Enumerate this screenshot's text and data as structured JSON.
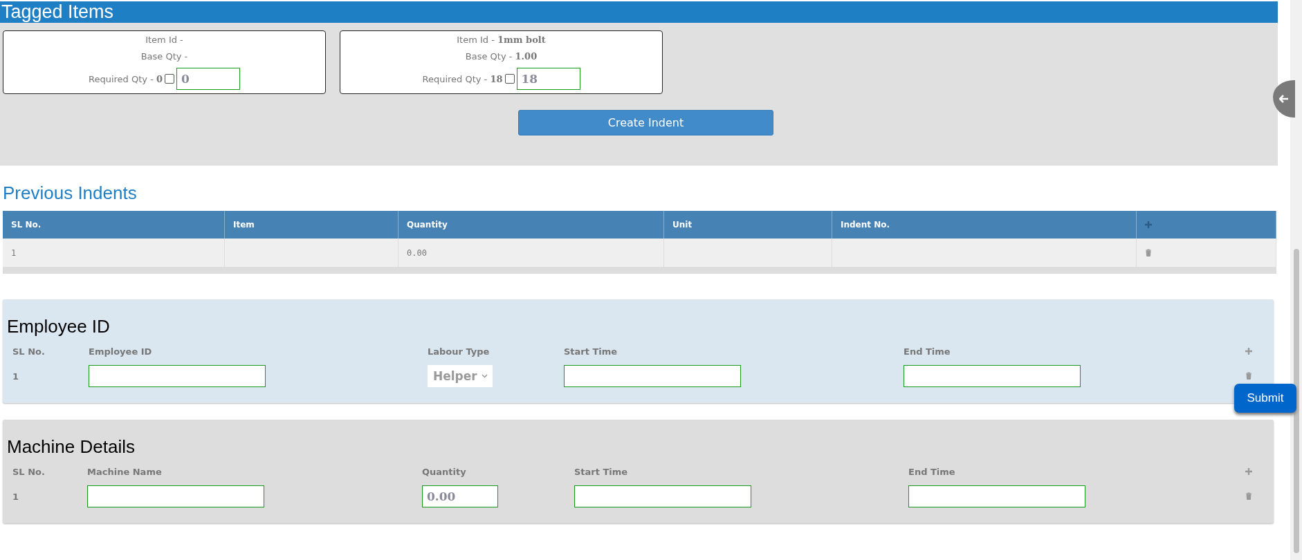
{
  "tagged_items": {
    "title": "Tagged Items",
    "cards": [
      {
        "item_id_label": "Item Id -",
        "base_qty_label": "Base Qty -",
        "required_label": "Required Qty -",
        "required_qty": "0",
        "checked": false,
        "value": "0"
      },
      {
        "item_id_label": "Item Id -",
        "item_id": "1mm bolt",
        "base_qty_label": "Base Qty -",
        "base_qty": "1.00",
        "required_label": "Required Qty -",
        "required_qty": "18",
        "checked": false,
        "value": "18"
      }
    ],
    "button": "Create Indent"
  },
  "previous_indents": {
    "title": "Previous Indents",
    "columns": [
      "SL No.",
      "Item",
      "Quantity",
      "Unit",
      "Indent No."
    ],
    "rows": [
      {
        "sl": "1",
        "quantity": "0.00"
      }
    ]
  },
  "employee": {
    "title": "Employee ID",
    "columns": [
      "SL No.",
      "Employee ID",
      "Labour Type",
      "Start Time",
      "End Time"
    ],
    "rows": [
      {
        "sl": "1",
        "labour_type": "Helper"
      }
    ]
  },
  "machine": {
    "title": "Machine Details",
    "columns": [
      "SL No.",
      "Machine Name",
      "Quantity",
      "Start Time",
      "End Time"
    ],
    "rows": [
      {
        "sl": "1",
        "quantity": "0.00"
      }
    ]
  },
  "submit": "Submit"
}
